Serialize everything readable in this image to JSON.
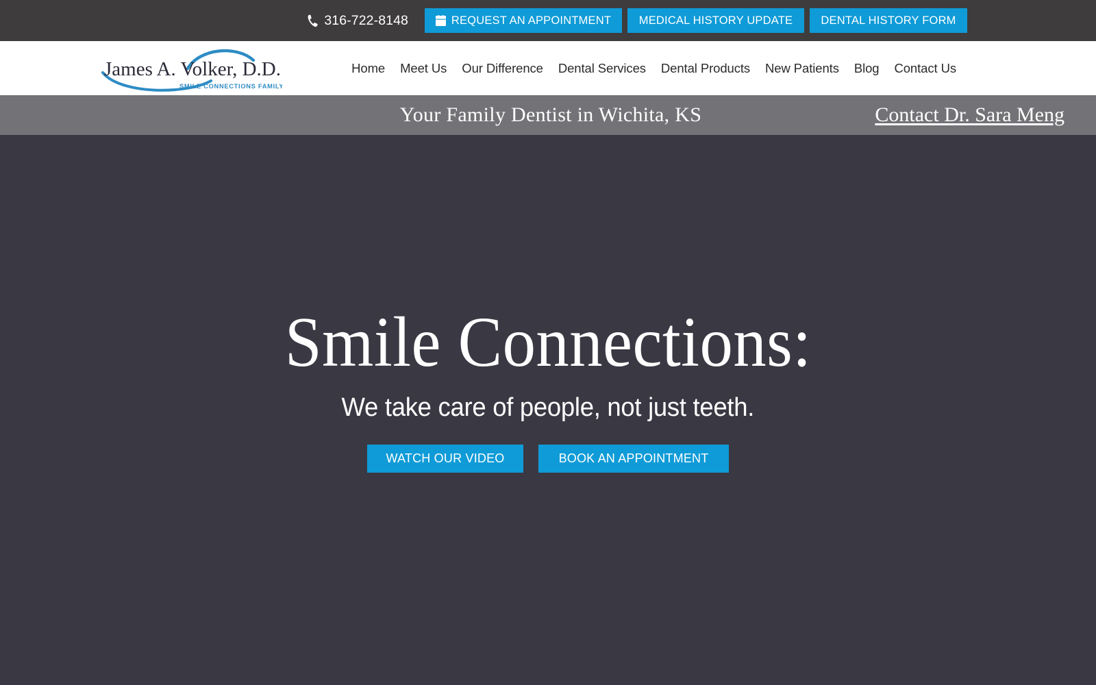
{
  "topbar": {
    "phone": "316-722-8148",
    "phone_icon": "phone-icon",
    "buttons": [
      {
        "label": "REQUEST AN APPOINTMENT",
        "icon": "calendar-icon"
      },
      {
        "label": "MEDICAL HISTORY UPDATE",
        "icon": ""
      },
      {
        "label": "DENTAL HISTORY FORM",
        "icon": ""
      }
    ]
  },
  "header": {
    "logo": {
      "name": "James A. Volker, D.D.S.",
      "tagline": "SMILE CONNECTIONS FAMILY DENTAL"
    },
    "nav": [
      {
        "label": "Home"
      },
      {
        "label": "Meet Us"
      },
      {
        "label": "Our Difference"
      },
      {
        "label": "Dental Services"
      },
      {
        "label": "Dental Products"
      },
      {
        "label": "New Patients"
      },
      {
        "label": "Blog"
      },
      {
        "label": "Contact Us"
      }
    ]
  },
  "tagline_bar": {
    "text": "Your Family Dentist in Wichita, KS",
    "contact_link": "Contact Dr. Sara Meng"
  },
  "hero": {
    "title": "Smile Connections:",
    "subtitle": "We take care of people, not just teeth.",
    "buttons": [
      {
        "label": "WATCH OUR VIDEO"
      },
      {
        "label": "BOOK AN APPOINTMENT"
      }
    ]
  },
  "colors": {
    "accent_blue": "#0f9bd7",
    "topbar_dark": "#3e3c3c",
    "tagline_gray": "#737276",
    "hero_dark": "#3a3843",
    "logo_blue": "#2e8cc4"
  }
}
